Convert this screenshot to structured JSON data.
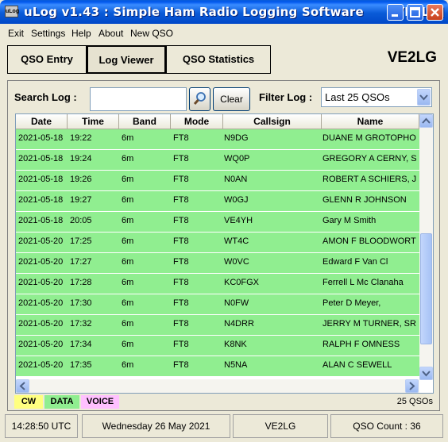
{
  "window": {
    "title": "uLog v1.43 : Simple Ham Radio Logging Software      [VE2LG]",
    "icon_label": "uLog"
  },
  "menu": [
    "Exit",
    "Settings",
    "Help",
    "About",
    "New QSO"
  ],
  "tabs": [
    {
      "label": "QSO Entry",
      "active": false
    },
    {
      "label": "Log Viewer",
      "active": true
    },
    {
      "label": "QSO Statistics",
      "active": false
    }
  ],
  "station_callsign": "VE2LG",
  "search": {
    "label": "Search Log :",
    "value": "",
    "search_icon": "magnifier-icon",
    "clear_label": "Clear"
  },
  "filter": {
    "label": "Filter Log :",
    "selected": "Last 25 QSOs"
  },
  "table": {
    "columns": [
      "Date",
      "Time",
      "Band",
      "Mode",
      "Callsign",
      "Name"
    ],
    "rows": [
      [
        "2021-05-18",
        "19:22",
        "6m",
        "FT8",
        "N9DG",
        "DUANE M GROTOPHO..."
      ],
      [
        "2021-05-18",
        "19:24",
        "6m",
        "FT8",
        "WQ0P",
        "GREGORY A CERNY, SR"
      ],
      [
        "2021-05-18",
        "19:26",
        "6m",
        "FT8",
        "N0AN",
        "ROBERT A SCHIERS, JR"
      ],
      [
        "2021-05-18",
        "19:27",
        "6m",
        "FT8",
        "W0GJ",
        "GLENN R JOHNSON"
      ],
      [
        "2021-05-18",
        "20:05",
        "6m",
        "FT8",
        "VE4YH",
        "Gary M Smith"
      ],
      [
        "2021-05-20",
        "17:25",
        "6m",
        "FT8",
        "WT4C",
        "AMON F BLOODWORTH"
      ],
      [
        "2021-05-20",
        "17:27",
        "6m",
        "FT8",
        "W0VC",
        "Edward F Van Cl"
      ],
      [
        "2021-05-20",
        "17:28",
        "6m",
        "FT8",
        "KC0FGX",
        "Ferrell L Mc Clanaha"
      ],
      [
        "2021-05-20",
        "17:30",
        "6m",
        "FT8",
        "N0FW",
        "Peter D Meyer,"
      ],
      [
        "2021-05-20",
        "17:32",
        "6m",
        "FT8",
        "N4DRR",
        "JERRY M TURNER, SR"
      ],
      [
        "2021-05-20",
        "17:34",
        "6m",
        "FT8",
        "K8NK",
        "RALPH F OMNESS"
      ],
      [
        "2021-05-20",
        "17:35",
        "6m",
        "FT8",
        "N5NA",
        "ALAN C SEWELL"
      ]
    ],
    "row_color": "#90ee90"
  },
  "legend": [
    {
      "label": "CW",
      "color": "#ffff80"
    },
    {
      "label": "DATA",
      "color": "#90ee90"
    },
    {
      "label": "VOICE",
      "color": "#ffc0ff"
    }
  ],
  "qso_shown": "25 QSOs",
  "status": {
    "utc_time": "14:28:50  UTC",
    "date": "Wednesday 26 May 2021",
    "callsign": "VE2LG",
    "qso_count": "QSO Count : 36"
  },
  "colors": {
    "titlebar": "#0058ee",
    "close_button": "#c8401c",
    "window_bg": "#ece9d8"
  }
}
